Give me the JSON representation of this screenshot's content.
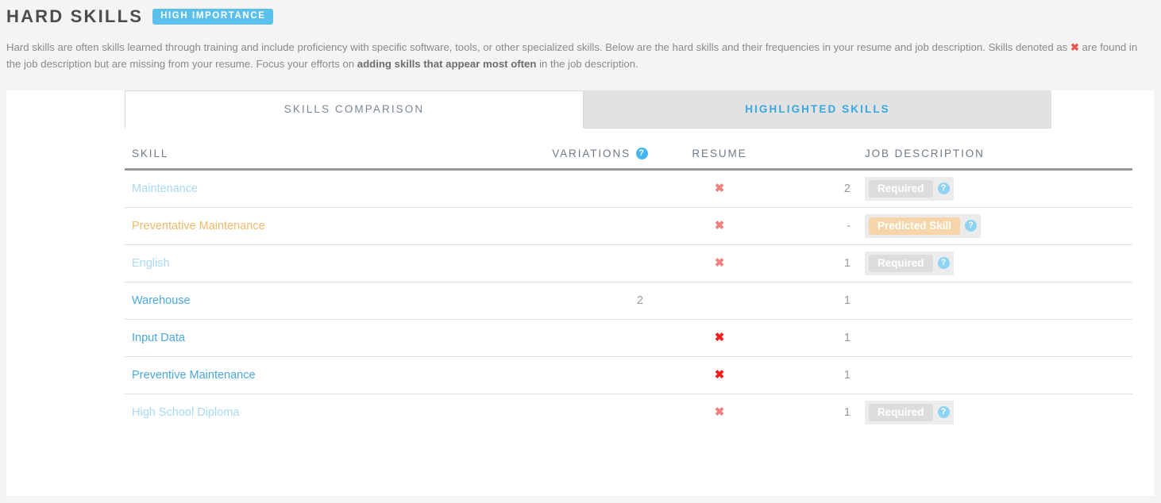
{
  "header": {
    "title": "HARD SKILLS",
    "importance_badge": "HIGH IMPORTANCE",
    "importance_badge_color": "#5bc0eb",
    "description_part1": "Hard skills are often skills learned through training and include proficiency with specific software, tools, or other specialized skills. Below are the hard skills and their frequencies in your resume and job description. Skills denoted as ",
    "description_x_icon": "✖",
    "description_part2": " are found in the job description but are missing from your resume. Focus your efforts on ",
    "description_bold": "adding skills that appear most often",
    "description_part3": " in the job description."
  },
  "tabs": [
    {
      "label": "SKILLS COMPARISON",
      "active": true
    },
    {
      "label": "HIGHLIGHTED SKILLS",
      "active": false
    }
  ],
  "table": {
    "columns": {
      "skill": "SKILL",
      "variations": "VARIATIONS",
      "resume": "RESUME",
      "job_description": "JOB DESCRIPTION"
    },
    "variations_help_icon": "?",
    "rows": [
      {
        "skill": "Maintenance",
        "skill_style": "faded",
        "variations": "",
        "resume": "✖",
        "resume_style": "faded",
        "jd_count": "2",
        "badge": "Required",
        "badge_type": "required",
        "badge_help_icon": "?"
      },
      {
        "skill": "Preventative Maintenance",
        "skill_style": "orange",
        "variations": "",
        "resume": "✖",
        "resume_style": "faded",
        "jd_count": "-",
        "badge": "Predicted Skill",
        "badge_type": "predicted",
        "badge_help_icon": "?"
      },
      {
        "skill": "English",
        "skill_style": "faded",
        "variations": "",
        "resume": "✖",
        "resume_style": "faded",
        "jd_count": "1",
        "badge": "Required",
        "badge_type": "required",
        "badge_help_icon": "?"
      },
      {
        "skill": "Warehouse",
        "skill_style": "strong",
        "variations": "2",
        "resume": "",
        "resume_style": "none",
        "jd_count": "1",
        "badge": "",
        "badge_type": "none",
        "badge_help_icon": ""
      },
      {
        "skill": "Input Data",
        "skill_style": "strong",
        "variations": "",
        "resume": "✖",
        "resume_style": "solid",
        "jd_count": "1",
        "badge": "",
        "badge_type": "none",
        "badge_help_icon": ""
      },
      {
        "skill": "Preventive Maintenance",
        "skill_style": "strong",
        "variations": "",
        "resume": "✖",
        "resume_style": "solid",
        "jd_count": "1",
        "badge": "",
        "badge_type": "none",
        "badge_help_icon": ""
      },
      {
        "skill": "High School Diploma",
        "skill_style": "faded",
        "variations": "",
        "resume": "✖",
        "resume_style": "faded",
        "jd_count": "1",
        "badge": "Required",
        "badge_type": "required",
        "badge_help_icon": "?"
      }
    ]
  },
  "colors": {
    "accent_blue": "#38a8e0",
    "skill_strong": "#4aa8e0",
    "skill_faded": "#a8d8f2",
    "skill_orange": "#f0b96a",
    "x_solid": "#f71c1c",
    "x_faded": "#f08080",
    "predicted_badge": "#f6d5a8",
    "required_badge": "#dcdcdc",
    "page_background": "#f4f4f4"
  }
}
